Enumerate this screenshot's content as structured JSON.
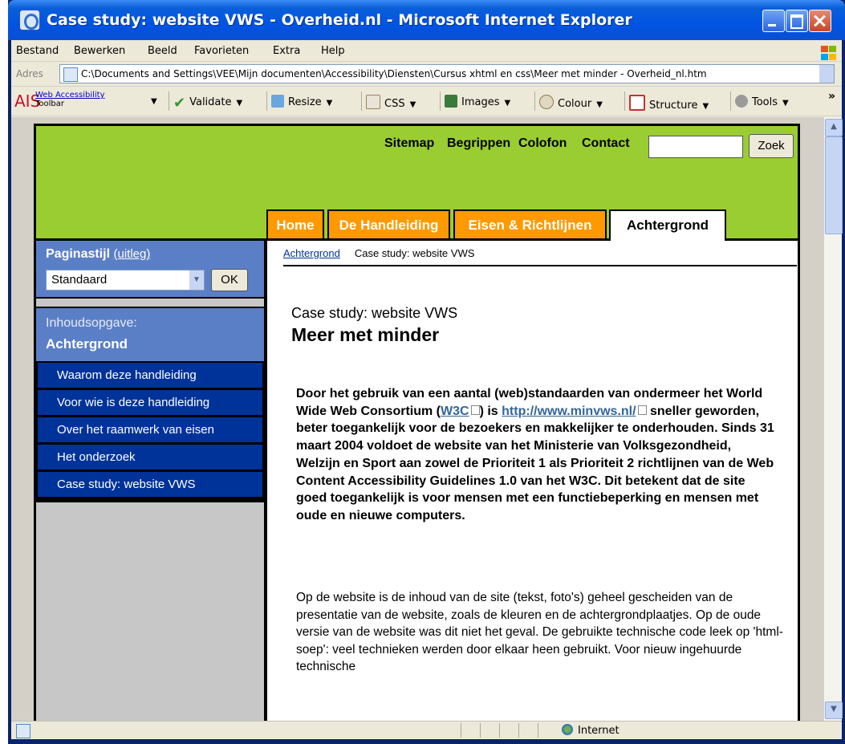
{
  "window": {
    "title": "Case study: website VWS - Overheid.nl - Microsoft Internet Explorer"
  },
  "menu": [
    "Bestand",
    "Bewerken",
    "Beeld",
    "Favorieten",
    "Extra",
    "Help"
  ],
  "address": {
    "label": "Adres",
    "value": "C:\\Documents and Settings\\VEE\\Mijn documenten\\Accessibility\\Diensten\\Cursus xhtml en css\\Meer met minder - Overheid_nl.htm"
  },
  "ais_toolbar": {
    "logo": "AIS",
    "name_line1": "Web Accessibility",
    "name_line2": "Toolbar",
    "tools": [
      "Validate",
      "Resize",
      "CSS",
      "Images",
      "Colour",
      "Structure",
      "Tools"
    ],
    "overflow": "»"
  },
  "site": {
    "top_links": [
      "Sitemap",
      "Begrippen",
      "Colofon",
      "Contact"
    ],
    "search_value": "",
    "search_button": "Zoek",
    "tabs": [
      "Home",
      "De Handleiding",
      "Eisen & Richtlijnen",
      "Achtergrond"
    ],
    "active_tab": "Achtergrond",
    "colors": {
      "header": "#9acd32",
      "tab_orange": "#ff9900",
      "nav_blue": "#003399",
      "panel_blue": "#5b7fc6"
    }
  },
  "style_panel": {
    "title": "Paginastijl",
    "link": "(uitleg)",
    "selected": "Standaard",
    "ok": "OK"
  },
  "toc": {
    "label": "Inhoudsopgave:",
    "section": "Achtergrond",
    "items": [
      "Waarom deze handleiding",
      "Voor wie is deze handleiding",
      "Over het raamwerk van eisen",
      "Het onderzoek",
      "Case study: website VWS"
    ]
  },
  "content": {
    "breadcrumb_link": "Achtergrond",
    "breadcrumb_current": "Case study: website VWS",
    "kicker": "Case study: website VWS",
    "heading": "Meer met minder",
    "intro_1": "Door het gebruik van een aantal (web)standaarden van ondermeer het World Wide Web Consortium (",
    "intro_w3c": "W3C",
    "intro_2": ") is",
    "intro_url": "http://www.minvws.nl/",
    "intro_3": " sneller geworden, beter toegankelijk voor de bezoekers en makkelijker te onderhouden. Sinds 31 maart 2004 voldoet de website van het Ministerie van Volksgezondheid, Welzijn en Sport aan zowel de Prioriteit 1 als Prioriteit 2 richtlijnen van de Web Content Accessibility Guidelines 1.0 van het W3C. Dit betekent dat de site goed toegankelijk is voor mensen met een functiebeperking en mensen met oude en nieuwe computers.",
    "body": "Op de website is de inhoud van de site (tekst, foto's) geheel gescheiden van de presentatie van de website, zoals de kleuren en de achtergrondplaatjes. Op de oude versie van de website was dit niet het geval. De gebruikte technische code leek op 'html-soep': veel technieken werden door elkaar heen gebruikt. Voor nieuw ingehuurde technische"
  },
  "status": {
    "zone": "Internet"
  }
}
